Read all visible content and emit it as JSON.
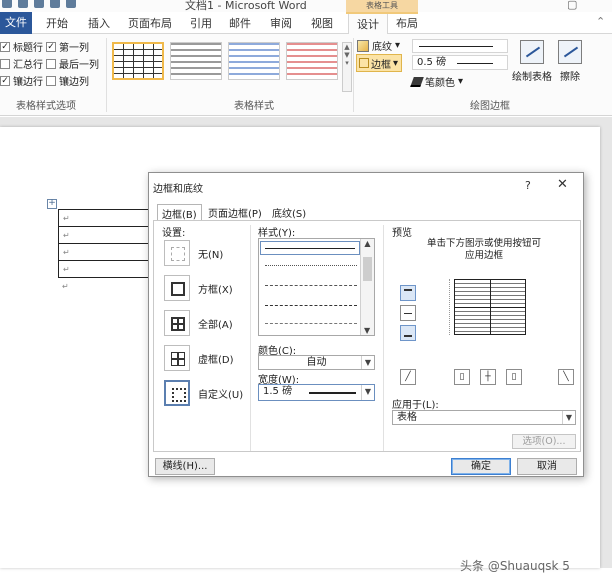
{
  "window": {
    "title": "文档1 - Microsoft Word",
    "context_tab_title": "表格工具"
  },
  "ribbon": {
    "tabs": {
      "file": "文件",
      "home": "开始",
      "insert": "插入",
      "layout": "页面布局",
      "references": "引用",
      "mailings": "邮件",
      "review": "审阅",
      "view": "视图",
      "design": "设计",
      "table_layout": "布局"
    },
    "style_options": {
      "group_label": "表格样式选项",
      "header_row": "标题行",
      "first_column": "第一列",
      "total_row": "汇总行",
      "last_column": "最后一列",
      "banded_rows": "镶边行",
      "banded_columns": "镶边列"
    },
    "table_styles": {
      "group_label": "表格样式"
    },
    "borders": {
      "shading": "底纹",
      "borders": "边框",
      "pen_weight": "0.5 磅",
      "pen_color": "笔颜色",
      "draw_table": "绘制表格",
      "eraser": "擦除",
      "group_label": "绘图边框"
    }
  },
  "document": {
    "para_mark": "↵",
    "rows": 4,
    "watermark": "头条 @Shuauqsk 5"
  },
  "dialog": {
    "title": "边框和底纹",
    "help": "?",
    "close": "✕",
    "tabs": {
      "borders": "边框(B)",
      "page_border": "页面边框(P)",
      "shading": "底纹(S)"
    },
    "setting_label": "设置:",
    "settings": {
      "none": "无(N)",
      "box": "方框(X)",
      "all": "全部(A)",
      "grid": "虚框(D)",
      "custom": "自定义(U)"
    },
    "style_label": "样式(Y):",
    "color_label": "颜色(C):",
    "color_value": "自动",
    "width_label": "宽度(W):",
    "width_value": "1.5 磅",
    "preview_label": "预览",
    "preview_hint": "单击下方图示或使用按钮可应用边框",
    "apply_label": "应用于(L):",
    "apply_value": "表格",
    "options_button": "选项(O)...",
    "horizontal_line_button": "横线(H)...",
    "ok_button": "确定",
    "cancel_button": "取消"
  }
}
